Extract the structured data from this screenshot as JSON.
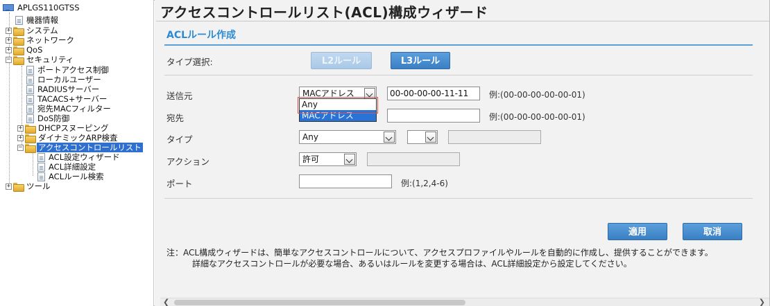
{
  "sidebar": {
    "root": "APLGS110GTSS",
    "items": [
      {
        "label": "機器情報"
      },
      {
        "label": "システム"
      },
      {
        "label": "ネットワーク"
      },
      {
        "label": "QoS"
      },
      {
        "label": "セキュリティ"
      },
      {
        "label": "ポートアクセス制御"
      },
      {
        "label": "ローカルユーザー"
      },
      {
        "label": "RADIUSサーバー"
      },
      {
        "label": "TACACS+サーバー"
      },
      {
        "label": "宛先MACフィルター"
      },
      {
        "label": "DoS防御"
      },
      {
        "label": "DHCPスヌーピング"
      },
      {
        "label": "ダイナミックARP検査"
      },
      {
        "label": "アクセスコントロールリスト"
      },
      {
        "label": "ACL設定ウィザード"
      },
      {
        "label": "ACL詳細設定"
      },
      {
        "label": "ACLルール検索"
      },
      {
        "label": "ツール"
      }
    ]
  },
  "main": {
    "title": "アクセスコントロールリスト(ACL)構成ウィザード",
    "section_title": "ACLルール作成",
    "type_select_label": "タイプ選択:",
    "l2_button": "L2ルール",
    "l3_button": "L3ルール",
    "source": {
      "label": "送信元",
      "select_value": "MACアドレス",
      "input_value": "00-00-00-00-11-11",
      "hint": "例:(00-00-00-00-00-01)",
      "dropdown_options": [
        "Any",
        "MACアドレス"
      ]
    },
    "destination": {
      "label": "宛先",
      "input_value": "",
      "hint": "例:(00-00-00-00-00-01)"
    },
    "type": {
      "label": "タイプ",
      "select_value": "Any",
      "select2_value": ""
    },
    "action": {
      "label": "アクション",
      "select_value": "許可"
    },
    "port": {
      "label": "ポート",
      "input_value": "",
      "hint": "例:(1,2,4-6)"
    },
    "apply_button": "適用",
    "cancel_button": "取消",
    "note_line1": "注：ACL構成ウィザードは、簡単なアクセスコントロールについて、アクセスプロファイルやルールを自動的に作成し、提供することができます。",
    "note_line2": "詳細なアクセスコントロールが必要な場合、あるいはルールを変更する場合は、ACL詳細設定から設定してください。"
  },
  "colors": {
    "accent": "#2a8bd4",
    "button_blue": "#3a7fc3",
    "selected_tree": "#2f6fd0"
  }
}
